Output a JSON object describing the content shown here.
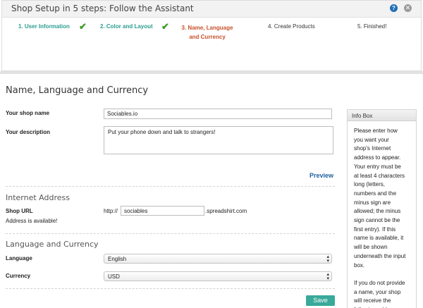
{
  "wizard": {
    "title": "Shop Setup in 5 steps: Follow the Assistant",
    "help_glyph": "?",
    "close_glyph": "✕",
    "steps": [
      {
        "label": "1. User Information"
      },
      {
        "label": "2. Color and Layout"
      },
      {
        "label": "3. Name, Language and Currency"
      },
      {
        "label": "4. Create Products"
      },
      {
        "label": "5. Finished!"
      }
    ],
    "check_glyph": "✔"
  },
  "form": {
    "title": "Name, Language and Currency",
    "shop_name_label": "Your shop name",
    "shop_name_value": "Sociables.io",
    "description_label": "Your description",
    "description_value": "Put your phone down and talk to strangers!",
    "preview_label": "Preview",
    "internet_address_title": "Internet Address",
    "shop_url_label": "Shop URL",
    "url_prefix": "http://",
    "url_value": "sociables",
    "url_suffix": ".spreadshirt.com",
    "availability": "Address is available!",
    "lang_currency_title": "Language and Currency",
    "language_label": "Language",
    "language_value": "English",
    "currency_label": "Currency",
    "currency_value": "USD",
    "save_label": "Save"
  },
  "infobox": {
    "title": "Info Box",
    "body": "Please enter how\nyou want your\nshop's Internet\naddress to appear.\nYour entry must be\nat least 4 characters\nlong (letters,\nnumbers and the\nminus sign are\nallowed; the minus\nsign cannot be the\nfirst entry). If this\nname is available, it\nwill be shown\nunderneath the input\nbox.\n\nIf you do not provide\na name, your shop\nwill receive the\nfollowing address:"
  },
  "colors": {
    "done_step": "#2a9d8f",
    "active_step": "#c8502a",
    "check": "#3f9a26",
    "link": "#1f5fa0",
    "save_button": "#39a99a"
  }
}
